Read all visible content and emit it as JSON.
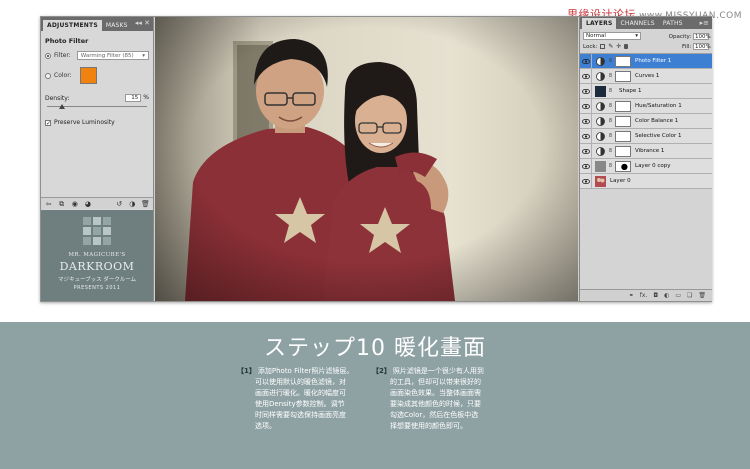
{
  "watermark": {
    "text": "思缘设计论坛",
    "url": "www.MISSYUAN.COM"
  },
  "adjustments": {
    "tabs": [
      "ADJUSTMENTS",
      "MASKS"
    ],
    "panel_title": "Photo Filter",
    "filter_label": "Filter:",
    "filter_value": "Warming Filter (85)",
    "color_label": "Color:",
    "color_value": "#f0830f",
    "density_label": "Density:",
    "density_value": "15",
    "density_unit": "%",
    "density_fraction": 0.15,
    "preserve_label": "Preserve Luminosity",
    "preserve_checked": true
  },
  "darkroom": {
    "line1": "MR. MAGICUBE'S",
    "line2": "DARKROOM",
    "line3": "マジキューブッス ダークルーム",
    "line4": "PRESENTS 2011"
  },
  "layers_panel": {
    "tabs": [
      "LAYERS",
      "CHANNELS",
      "PATHS"
    ],
    "blend_mode": "Normal",
    "opacity_label": "Opacity:",
    "opacity_value": "100%",
    "lock_label": "Lock:",
    "fill_label": "Fill:",
    "fill_value": "100%",
    "layers": [
      {
        "name": "Photo Filter 1",
        "type": "adjustment",
        "selected": true
      },
      {
        "name": "Curves 1",
        "type": "adjustment",
        "selected": false
      },
      {
        "name": "Shape 1",
        "type": "shape",
        "selected": false
      },
      {
        "name": "Hue/Saturation 1",
        "type": "adjustment",
        "selected": false
      },
      {
        "name": "Color Balance 1",
        "type": "adjustment",
        "selected": false
      },
      {
        "name": "Selective Color 1",
        "type": "adjustment",
        "selected": false
      },
      {
        "name": "Vibrance 1",
        "type": "adjustment",
        "selected": false
      },
      {
        "name": "Layer 0 copy",
        "type": "pixel-masked",
        "selected": false
      },
      {
        "name": "Layer 0",
        "type": "pixel",
        "selected": false
      }
    ]
  },
  "step": {
    "title": "ステップ10 暖化畫面",
    "col1": {
      "num": "【1】",
      "lines": [
        "添加Photo Filter照片滤镜层。",
        "可以使用默认的暖色滤镜，对",
        "画面进行暖化。暖化的幅度可",
        "使用Density参数控制。调节",
        "时同样需要勾选保持画面亮度",
        "选项。"
      ]
    },
    "col2": {
      "num": "【2】",
      "lines": [
        "照片滤镜是一个很少有人用到",
        "的工具，但却可以带来很好的",
        "画面染色效果。当整体画面需",
        "要染成其他颜色的时候，只要",
        "勾选Color，然后在色板中选",
        "择想要使用的颜色即可。"
      ]
    }
  }
}
